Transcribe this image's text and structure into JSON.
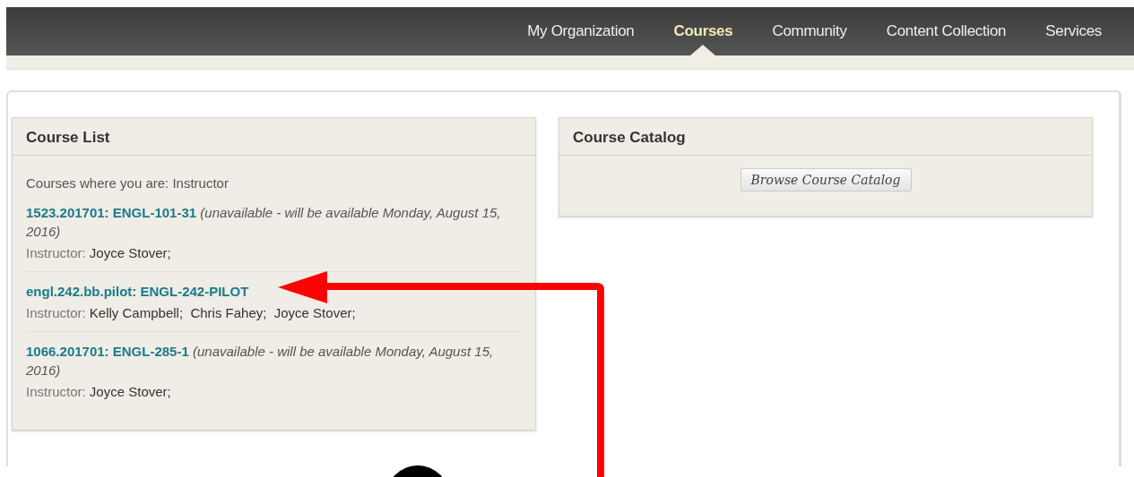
{
  "nav": {
    "items": [
      {
        "label": "My Organization",
        "selected": false
      },
      {
        "label": "Courses",
        "selected": true
      },
      {
        "label": "Community",
        "selected": false
      },
      {
        "label": "Content Collection",
        "selected": false
      },
      {
        "label": "Services",
        "selected": false
      }
    ]
  },
  "course_list": {
    "title": "Course List",
    "role_line": "Courses where you are: Instructor",
    "courses": [
      {
        "link": "1523.201701: ENGL-101-31",
        "note": "(unavailable - will be available Monday, August 15, 2016)",
        "instructor_label": "Instructor:",
        "instructors": "Joyce Stover;"
      },
      {
        "link": "engl.242.bb.pilot: ENGL-242-PILOT",
        "instructor_label": "Instructor:",
        "instructors": "Kelly Campbell;  Chris Fahey;  Joyce Stover;"
      },
      {
        "link": "1066.201701: ENGL-285-1",
        "note": "(unavailable - will be available Monday, August 15, 2016)",
        "instructor_label": "Instructor:",
        "instructors": "Joyce Stover;"
      }
    ]
  },
  "course_catalog": {
    "title": "Course Catalog",
    "button": "Browse Course Catalog"
  }
}
